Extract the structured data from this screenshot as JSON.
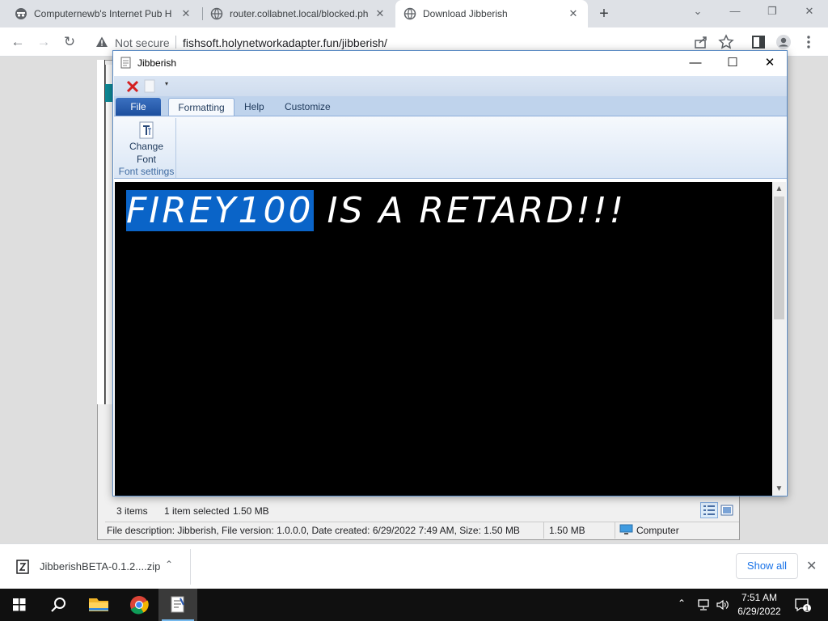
{
  "browser": {
    "tabs": [
      {
        "title": "Computernewb's Internet Pub H",
        "close": "✕"
      },
      {
        "title": "router.collabnet.local/blocked.ph",
        "close": "✕"
      },
      {
        "title": "Download Jibberish",
        "close": "✕"
      }
    ],
    "new_tab": "+",
    "window_controls": {
      "dropdown": "⌄",
      "minimize": "—",
      "restore": "❐",
      "close": "✕"
    },
    "nav": {
      "back": "←",
      "forward": "→",
      "reload": "↻"
    },
    "security_label": "Not secure",
    "url": "fishsoft.holynetworkadapter.fun/jibberish/",
    "toolbar_icons": [
      "share-icon",
      "bookmark-star-icon",
      "sidebar-icon",
      "profile-icon",
      "menu-icon"
    ]
  },
  "jibberish": {
    "title": "Jibberish",
    "controls": {
      "minimize": "—",
      "maximize": "☐",
      "close": "✕"
    },
    "qat_dropdown": "▾",
    "ribbon_tabs": {
      "file": "File",
      "formatting": "Formatting",
      "help": "Help",
      "customize": "Customize"
    },
    "change_font_line1": "Change",
    "change_font_line2": "Font",
    "group_label": "Font settings",
    "text_selected": "FIREY100",
    "text_rest": " IS A RETARD!!!",
    "colors": {
      "editor_bg": "#000000",
      "editor_fg": "#ffffff",
      "selection": "#0a64c8"
    }
  },
  "explorer": {
    "items_count": "3 items",
    "items_selected": "1 item selected",
    "items_size": "1.50 MB",
    "file_description": "File description: Jibberish, File version: 1.0.0.0, Date created: 6/29/2022 7:49 AM, Size: 1.50 MB",
    "status_size": "1.50 MB",
    "location": "Computer"
  },
  "download": {
    "filename": "JibberishBETA-0.1.2....zip",
    "chevron": "⌃",
    "show_all": "Show all",
    "close": "✕"
  },
  "taskbar": {
    "tray_chevron": "⌃",
    "time": "7:51 AM",
    "date": "6/29/2022",
    "notification_count": "1"
  }
}
